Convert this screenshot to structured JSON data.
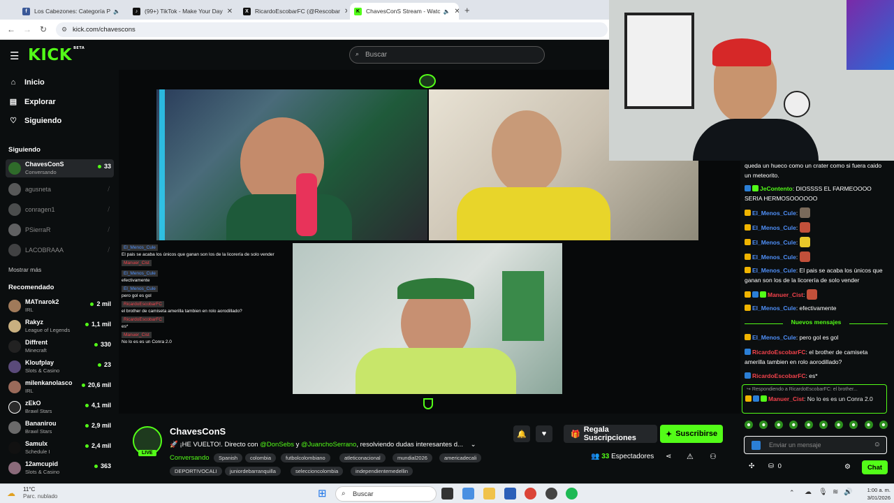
{
  "browser": {
    "tabs": [
      {
        "title": "Los Cabezones: Categoría P",
        "color": "#3b5998"
      },
      {
        "title": "(99+) TikTok - Make Your Day",
        "color": "#111111"
      },
      {
        "title": "RicardoEscobarFC (@Rescobar",
        "color": "#111111"
      },
      {
        "title": "ChavesConS Stream - Watc",
        "color": "#53fc18"
      }
    ],
    "url": "kick.com/chavescons"
  },
  "header": {
    "logo": "KICK",
    "logo_badge": "BETA",
    "search_placeholder": "Buscar"
  },
  "sidebar": {
    "nav": [
      {
        "label": "Inicio",
        "icon": "home-icon"
      },
      {
        "label": "Explorar",
        "icon": "compass-icon"
      },
      {
        "label": "Siguiendo",
        "icon": "heart-icon"
      }
    ],
    "following_title": "Siguiendo",
    "following": [
      {
        "name": "ChavesConS",
        "sub": "Conversando",
        "viewers": "33"
      },
      {
        "name": "agusneta"
      },
      {
        "name": "conragen1"
      },
      {
        "name": "PSierraR"
      },
      {
        "name": "LACOBRAAA"
      }
    ],
    "show_more": "Mostrar más",
    "recommended_title": "Recomendado",
    "recommended": [
      {
        "name": "MATnarok2",
        "sub": "IRL",
        "viewers": "2 mil"
      },
      {
        "name": "Rakyz",
        "sub": "League of Legends",
        "viewers": "1,1 mil"
      },
      {
        "name": "Diffrent",
        "sub": "Minecraft",
        "viewers": "330"
      },
      {
        "name": "Kloufplay",
        "sub": "Slots & Casino",
        "viewers": "23"
      },
      {
        "name": "milenkanolasco",
        "sub": "IRL",
        "viewers": "20,6 mil"
      },
      {
        "name": "zEkO",
        "sub": "Brawl Stars",
        "viewers": "4,1 mil"
      },
      {
        "name": "Bananirou",
        "sub": "Brawl Stars",
        "viewers": "2,9 mil"
      },
      {
        "name": "Samulx",
        "sub": "Schedule I",
        "viewers": "2,4 mil"
      },
      {
        "name": "12amcupid",
        "sub": "Slots & Casino",
        "viewers": "363"
      }
    ]
  },
  "overlay_chat": [
    {
      "user": "El_Menos_Cule",
      "text": "El pais se acaba los únicos que ganan son los de la licorería de solo vender"
    },
    {
      "user": "Manuer_Cist",
      "text": ""
    },
    {
      "user": "El_Menos_Cule",
      "text": "efectivamente"
    },
    {
      "user": "El_Menos_Cule",
      "text": "pero gol es gol"
    },
    {
      "user": "RicardoEscobarFC",
      "text": "el brother de camiseta amerilla tambien en rolo aorodillado?"
    },
    {
      "user": "RicardoEscobarFC",
      "text": "es*"
    },
    {
      "user": "Manuer_Cist",
      "text": "No lo es es un Conra 2.0"
    }
  ],
  "stream": {
    "channel": "ChavesConS",
    "live": "LIVE",
    "title_prefix": "🚀 ¡HE VUELTO!. Directo con ",
    "mention1": "@DonSebs",
    "title_mid": " y ",
    "mention2": "@JuanchoSerrano",
    "title_suffix": ", resolviendo dudas interesantes d...",
    "category": "Conversando",
    "tags_row1": [
      "Spanish",
      "colombia",
      "futbolcolombiano",
      "atleticonacional",
      "mundial2026",
      "americadecali"
    ],
    "tags_row2": [
      "DEPORTIVOCALI",
      "juniordebarranquilla",
      "seleccioncolombia",
      "independientemedellin"
    ],
    "gift_label": "Regala Suscripciones",
    "subscribe_label": "Suscribirse",
    "viewers": "33",
    "viewers_label": "Espectadores"
  },
  "chat": {
    "messages": [
      {
        "user": "",
        "text": "queda un hueco como un crater como si fuera caido un meteorito.",
        "user_color": "#ffffff"
      },
      {
        "user": "JeContento",
        "text": ": DIOSSSS EL FARMEOOOO SERIA HERMOSOOOOOO",
        "user_color": "#53fc18"
      },
      {
        "user": "El_Menos_Cule",
        "text": ":",
        "user_color": "#4f8ff7"
      },
      {
        "user": "El_Menos_Cule",
        "text": ":",
        "user_color": "#4f8ff7"
      },
      {
        "user": "El_Menos_Cule",
        "text": ":",
        "user_color": "#4f8ff7"
      },
      {
        "user": "El_Menos_Cule",
        "text": ":",
        "user_color": "#4f8ff7"
      },
      {
        "user": "El_Menos_Cule",
        "text": ": El pais se acaba los únicos que ganan son los de la licorería de solo vender",
        "user_color": "#4f8ff7"
      },
      {
        "user": "Manuer_Cist",
        "text": ":",
        "user_color": "#f2424b"
      },
      {
        "user": "El_Menos_Cule",
        "text": ": efectivamente",
        "user_color": "#4f8ff7"
      }
    ],
    "new_messages_label": "Nuevos mensajes",
    "messages_after": [
      {
        "user": "El_Menos_Cule",
        "text": ": pero gol es gol",
        "user_color": "#4f8ff7"
      },
      {
        "user": "RicardoEscobarFC",
        "text": ": el brother de camiseta amerilla tambien en rolo aorodillado?",
        "user_color": "#f2424b"
      },
      {
        "user": "RicardoEscobarFC",
        "text": ": es*",
        "user_color": "#f2424b"
      }
    ],
    "reply_context": "Respondiendo a RicardoEscobarFC: el brother...",
    "reply_user": "Manuer_Cist",
    "reply_text": ": No lo es es un Conra 2.0",
    "input_placeholder": "Enviar un mensaje",
    "points": "0",
    "send_label": "Chat"
  },
  "taskbar": {
    "temp": "11°C",
    "weather": "Parc. nublado",
    "search": "Buscar",
    "time": "1:00 a. m.",
    "date": "3/01/2026"
  },
  "colors": {
    "accent": "#53fc18",
    "bg": "#0b0e0f"
  }
}
